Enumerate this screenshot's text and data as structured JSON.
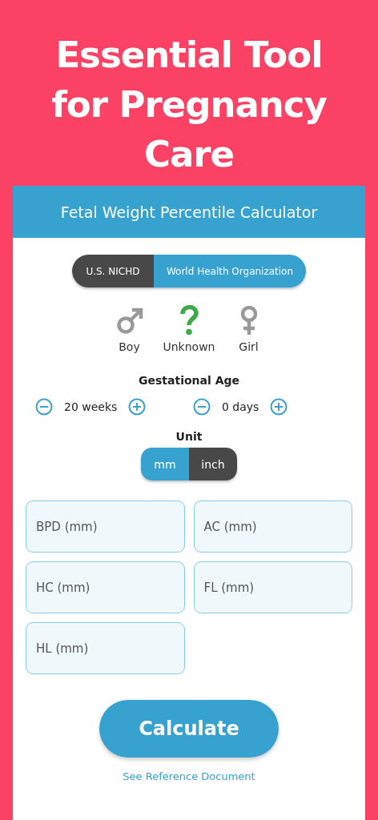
{
  "headline": "Essential Tool for Pregnancy Care",
  "card": {
    "title": "Fetal Weight Percentile Calculator"
  },
  "standards": [
    {
      "label": "U.S. NICHD",
      "selected": false
    },
    {
      "label": "World Health Organization",
      "selected": true
    }
  ],
  "genders": [
    {
      "kind": "boy",
      "label": "Boy",
      "selected": false
    },
    {
      "kind": "unknown",
      "label": "Unknown",
      "selected": true
    },
    {
      "kind": "girl",
      "label": "Girl",
      "selected": false
    }
  ],
  "gestational_age": {
    "title": "Gestational Age",
    "steppers": [
      {
        "value": "20 weeks"
      },
      {
        "value": "0 days"
      }
    ]
  },
  "unit": {
    "title": "Unit",
    "options": [
      {
        "label": "mm",
        "selected": true
      },
      {
        "label": "inch",
        "selected": false
      }
    ]
  },
  "fields": [
    {
      "placeholder": "BPD (mm)"
    },
    {
      "placeholder": "AC (mm)"
    },
    {
      "placeholder": "HC (mm)"
    },
    {
      "placeholder": "FL (mm)"
    },
    {
      "placeholder": "HL (mm)"
    }
  ],
  "calculate_button": "Calculate",
  "reference_link": "See Reference Document"
}
